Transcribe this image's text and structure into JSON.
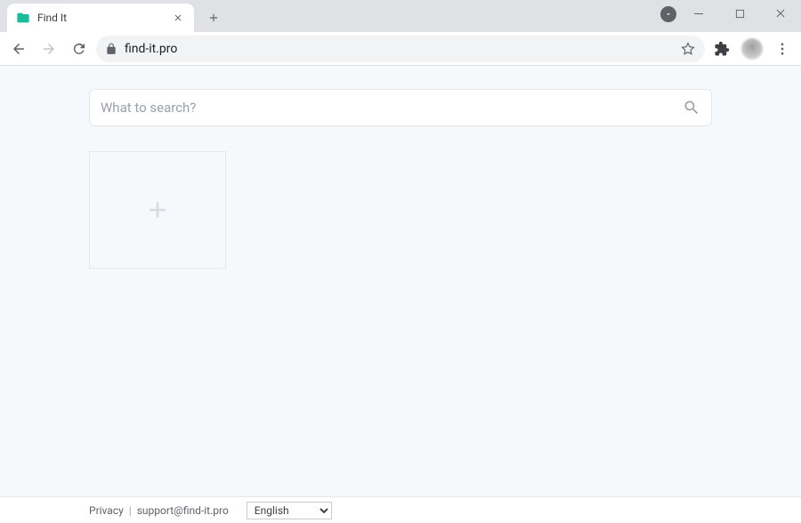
{
  "browser": {
    "tab_title": "Find It",
    "url": "find-it.pro"
  },
  "page": {
    "search_placeholder": "What to search?"
  },
  "footer": {
    "privacy_label": "Privacy",
    "separator": "|",
    "support_email": "support@find-it.pro",
    "language_options": [
      "English"
    ],
    "language_selected": "English"
  }
}
